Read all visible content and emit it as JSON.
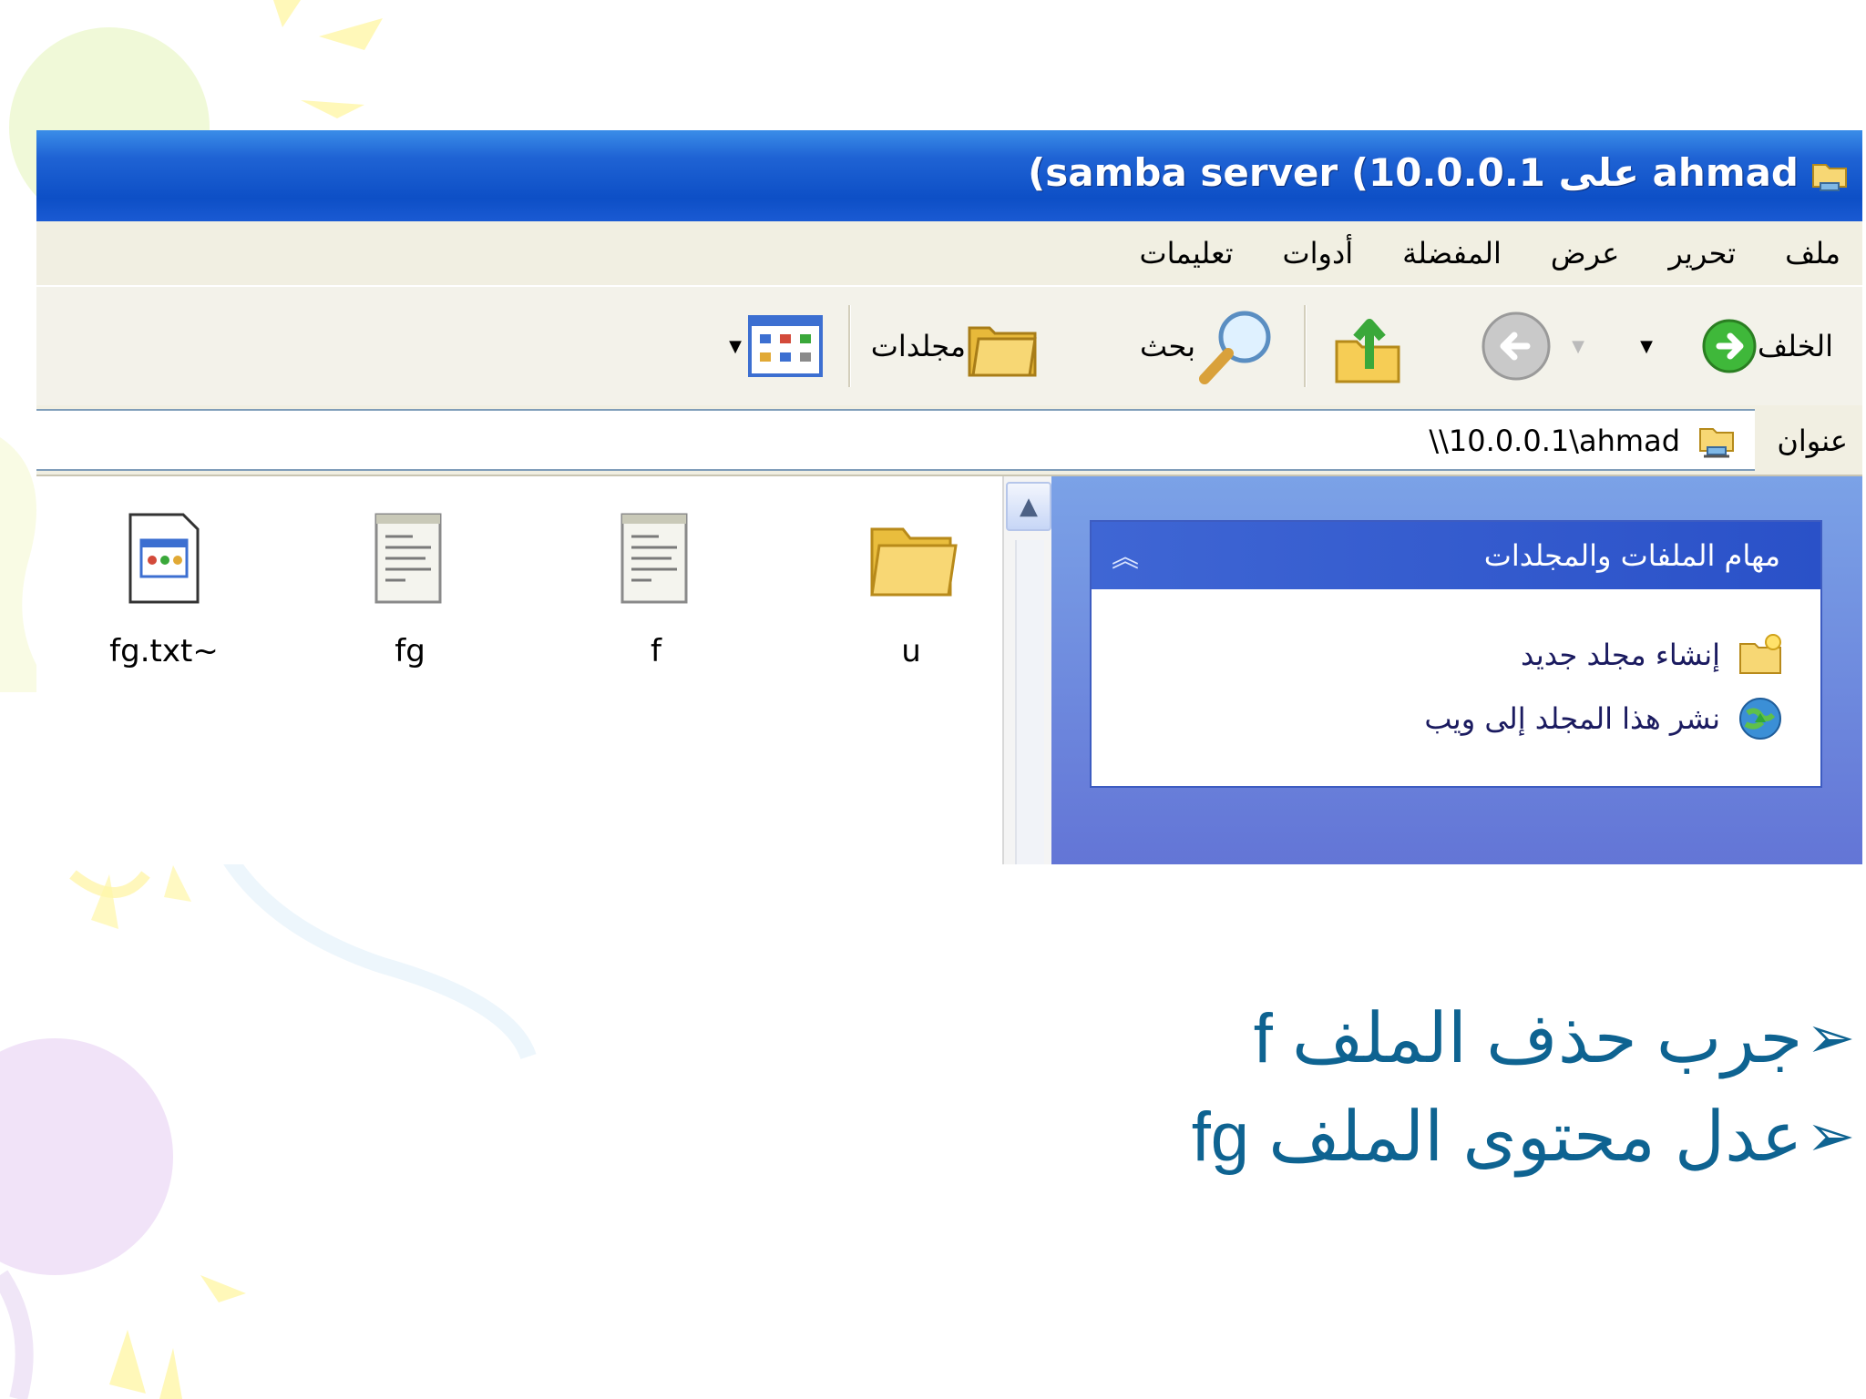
{
  "window": {
    "title": "(samba server (10.0.0.1 على ahmad"
  },
  "menu": {
    "items": [
      "ملف",
      "تحرير",
      "عرض",
      "المفضلة",
      "أدوات",
      "تعليمات"
    ]
  },
  "toolbar": {
    "back_label": "الخلف",
    "search_label": "بحث",
    "folders_label": "مجلدات"
  },
  "address": {
    "label": "عنوان",
    "value": "\\\\10.0.0.1\\ahmad"
  },
  "tasks": {
    "header": "مهام الملفات والمجلدات",
    "items": [
      {
        "label": "إنشاء مجلد جديد",
        "icon": "new-folder-icon"
      },
      {
        "label": "نشر هذا المجلد إلى ويب",
        "icon": "publish-web-icon"
      }
    ]
  },
  "files": [
    {
      "name": "u",
      "type": "folder"
    },
    {
      "name": "f",
      "type": "text-file"
    },
    {
      "name": "fg",
      "type": "text-file"
    },
    {
      "name": "fg.txt~",
      "type": "unknown-file"
    }
  ],
  "slide": {
    "bullets": [
      "جرب حذف الملف f",
      "عدل محتوى الملف fg"
    ],
    "bullet_marker": "➢"
  },
  "colors": {
    "titlebar": "#0d4fc6",
    "bullet_text": "#0e6391",
    "tasks_pane": "#6f8ce0"
  }
}
